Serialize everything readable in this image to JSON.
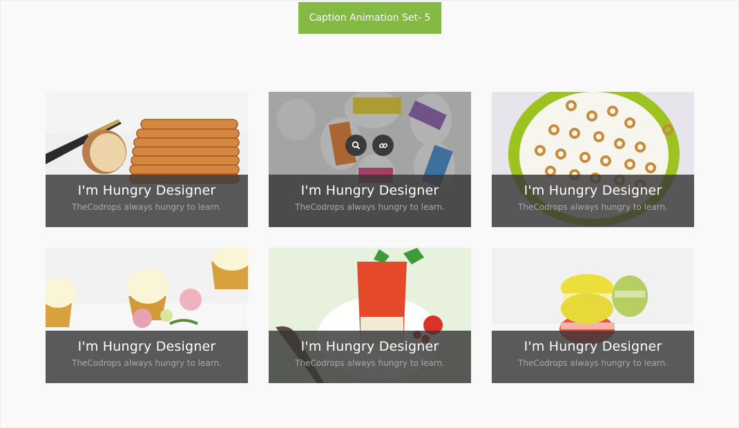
{
  "header": {
    "button_label": "Caption Animation Set- 5"
  },
  "cards": [
    {
      "title": "I'm Hungry Designer",
      "subtitle": "TheCodrops always hungry to learn.",
      "image": "bread-loaf-slices"
    },
    {
      "title": "I'm Hungry Designer",
      "subtitle": "TheCodrops always hungry to learn.",
      "image": "ribboned-eggs"
    },
    {
      "title": "I'm Hungry Designer",
      "subtitle": "TheCodrops always hungry to learn.",
      "image": "cereal-bowl"
    },
    {
      "title": "I'm Hungry Designer",
      "subtitle": "TheCodrops always hungry to learn.",
      "image": "cupcakes-roses"
    },
    {
      "title": "I'm Hungry Designer",
      "subtitle": "TheCodrops always hungry to learn.",
      "image": "strawberry-dessert"
    },
    {
      "title": "I'm Hungry Designer",
      "subtitle": "TheCodrops always hungry to learn.",
      "image": "macarons"
    }
  ],
  "hover_icons": [
    "search-icon",
    "link-icon"
  ],
  "colors": {
    "accent": "#84b944",
    "background": "#f9f9f9",
    "caption_overlay": "#373737"
  }
}
